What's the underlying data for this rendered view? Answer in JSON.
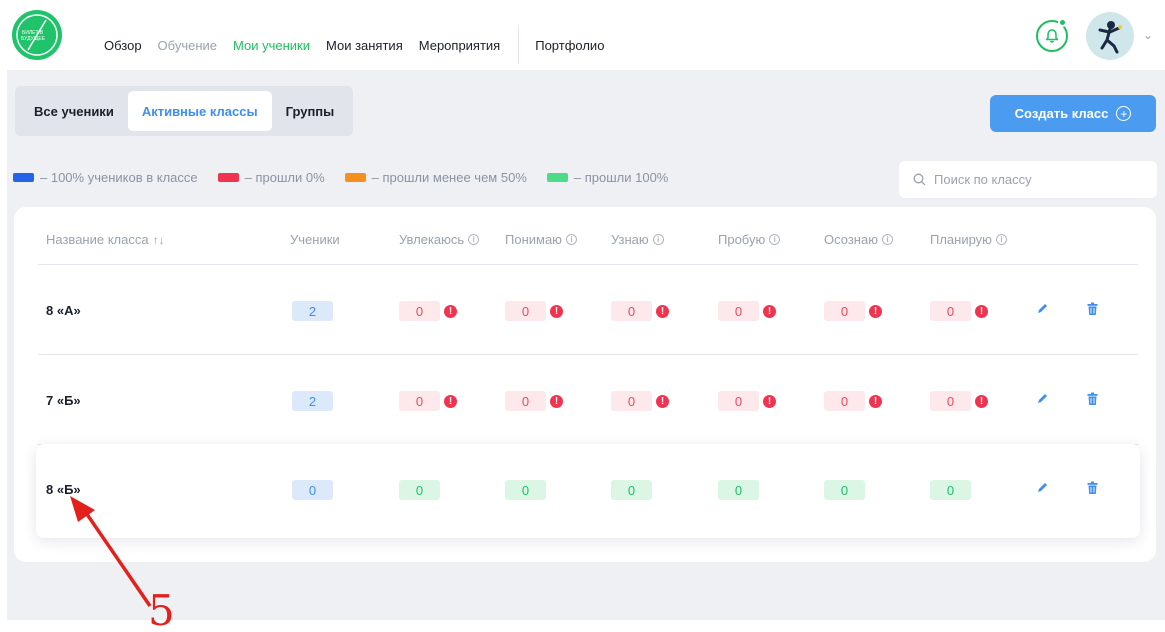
{
  "nav": {
    "items": [
      {
        "label": "Обзор",
        "state": "normal"
      },
      {
        "label": "Обучение",
        "state": "muted"
      },
      {
        "label": "Мои ученики",
        "state": "active"
      },
      {
        "label": "Мои занятия",
        "state": "normal"
      },
      {
        "label": "Мероприятия",
        "state": "normal"
      }
    ],
    "portfolio": "Портфолио",
    "logo_text": "БИЛЕТ В БУДУЩЕЕ"
  },
  "tabs": [
    "Все ученики",
    "Активные классы",
    "Группы"
  ],
  "create_button": "Создать класс",
  "legend": [
    {
      "label": "– 100% учеников в классе",
      "color": "#2563eb"
    },
    {
      "label": "– прошли 0%",
      "color": "#f0334f"
    },
    {
      "label": "– прошли менее чем 50%",
      "color": "#f5901f"
    },
    {
      "label": "– прошли 100%",
      "color": "#4cdb86"
    }
  ],
  "search": {
    "placeholder": "Поиск по классу"
  },
  "table": {
    "headers": {
      "name": "Название класса",
      "students": "Ученики",
      "stages": [
        "Увлекаюсь",
        "Понимаю",
        "Узнаю",
        "Пробую",
        "Осознаю",
        "Планирую"
      ]
    },
    "rows": [
      {
        "name": "8 «А»",
        "students": "2",
        "values": [
          "0",
          "0",
          "0",
          "0",
          "0",
          "0"
        ],
        "status": "red"
      },
      {
        "name": "7 «Б»",
        "students": "2",
        "values": [
          "0",
          "0",
          "0",
          "0",
          "0",
          "0"
        ],
        "status": "red"
      },
      {
        "name": "8 «Б»",
        "students": "0",
        "values": [
          "0",
          "0",
          "0",
          "0",
          "0",
          "0"
        ],
        "status": "green"
      }
    ]
  },
  "annotation": {
    "label": "5",
    "color": "#e3211c"
  }
}
